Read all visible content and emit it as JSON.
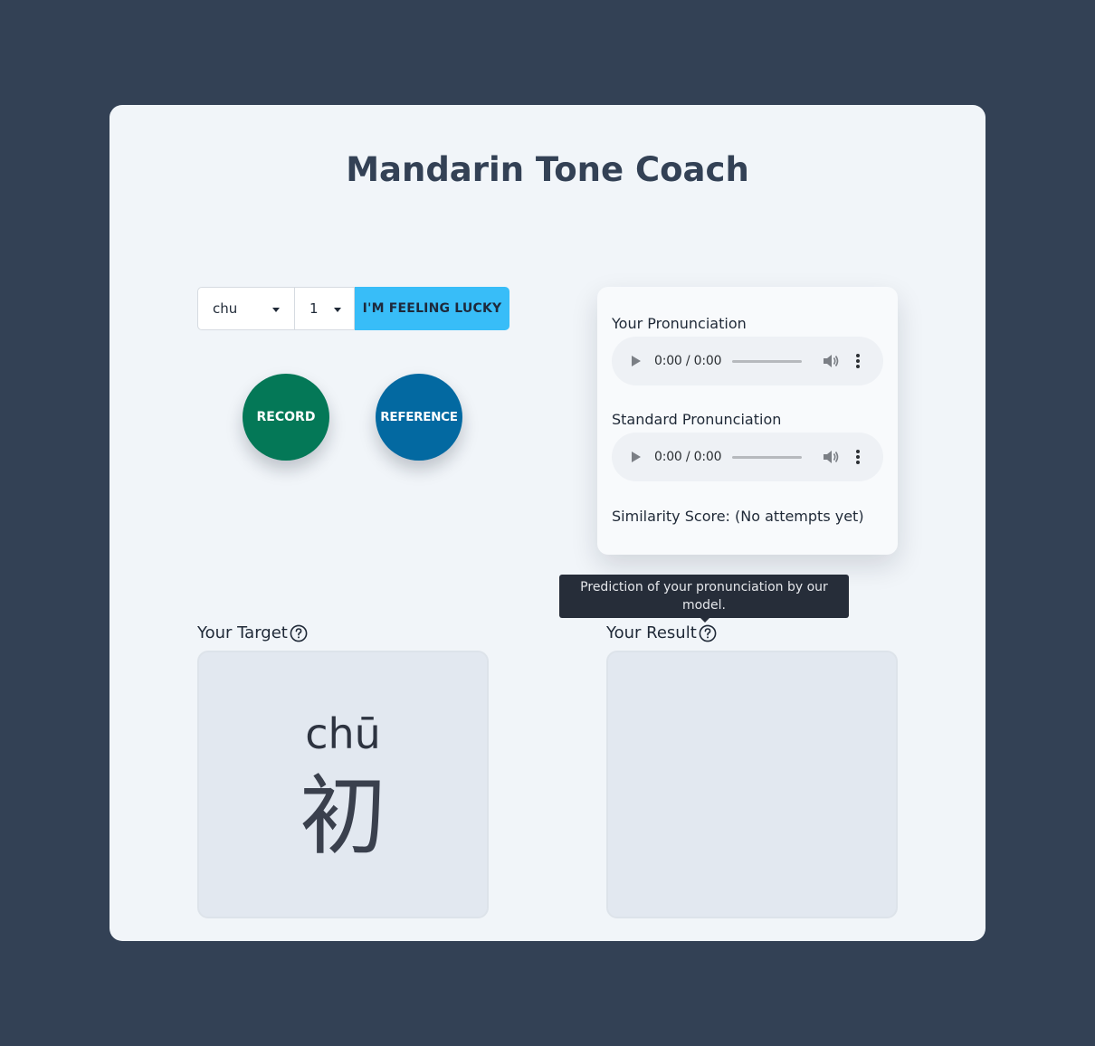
{
  "title": "Mandarin Tone Coach",
  "controls": {
    "syllable_value": "chu",
    "tone_value": "1",
    "lucky_label": "I'M FEELING LUCKY"
  },
  "buttons": {
    "record_label": "RECORD",
    "reference_label": "REFERENCE"
  },
  "audio_panel": {
    "your_label": "Your Pronunciation",
    "your_time": "0:00 / 0:00",
    "standard_label": "Standard Pronunciation",
    "standard_time": "0:00 / 0:00",
    "similarity": "Similarity Score: (No attempts yet)"
  },
  "tooltip": {
    "text": "Prediction of your pronunciation by our model."
  },
  "target": {
    "label": "Your Target",
    "pinyin": "chū",
    "hanzi": "初"
  },
  "result": {
    "label": "Your Result"
  },
  "colors": {
    "page_bg": "#334155",
    "card_bg": "#f1f5f9",
    "lucky_bg": "#38bdf8",
    "record_bg": "#047857",
    "reference_bg": "#0369a1"
  }
}
